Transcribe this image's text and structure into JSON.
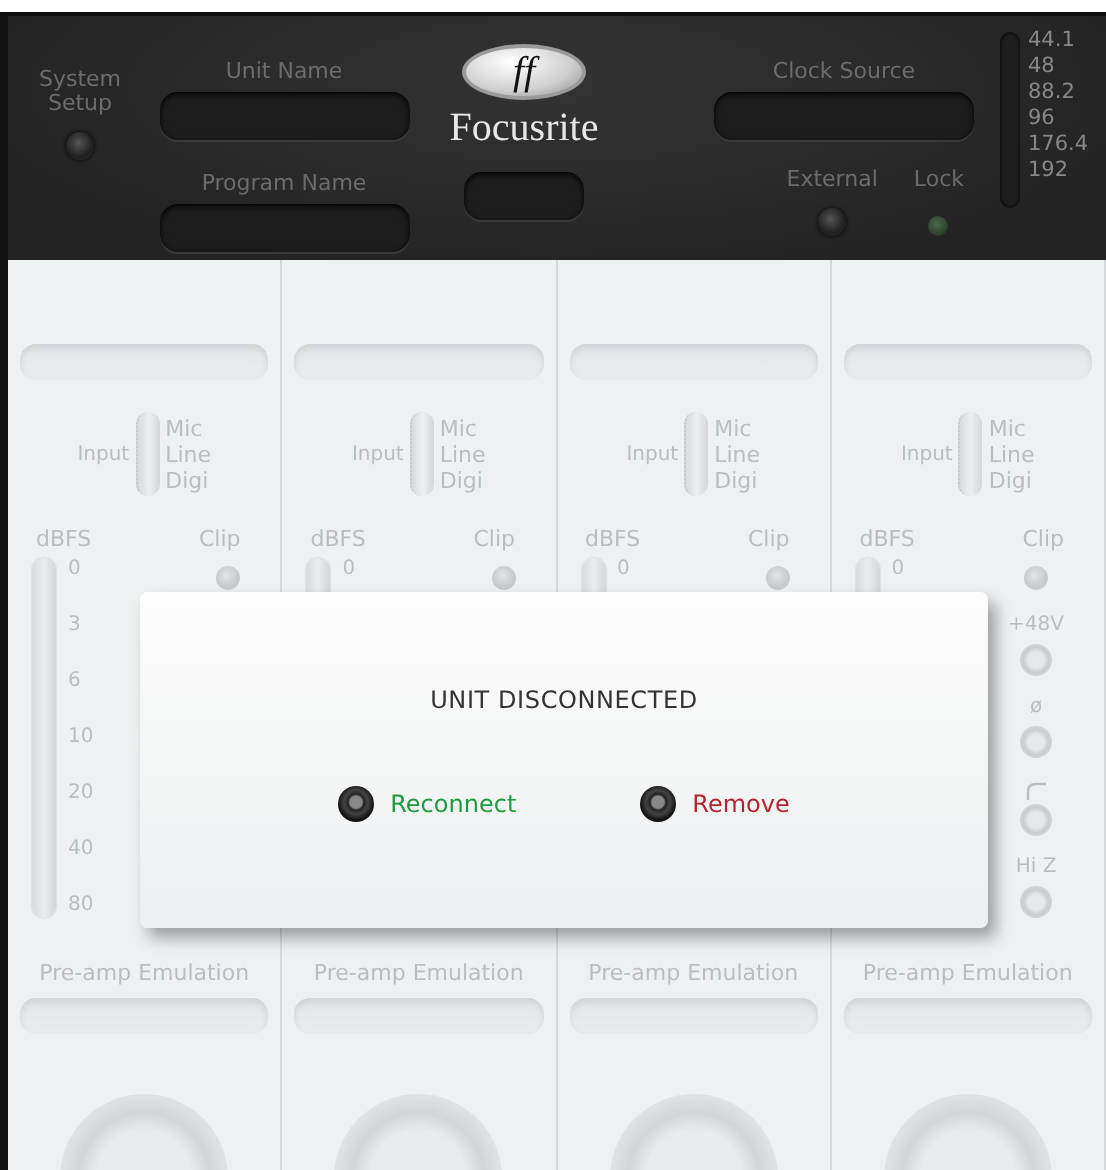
{
  "header": {
    "system_setup": "System Setup",
    "unit_name_label": "Unit Name",
    "program_name_label": "Program Name",
    "logo_mark": "ff",
    "logo_text": "Focusrite",
    "clock_source_label": "Clock Source",
    "external_label": "External",
    "lock_label": "Lock",
    "sample_rates": [
      "44.1",
      "48",
      "88.2",
      "96",
      "176.4",
      "192"
    ]
  },
  "channels": [
    {
      "input_label": "Input",
      "input_options": [
        "Mic",
        "Line",
        "Digi"
      ],
      "dbfs_label": "dBFS",
      "clip_label": "Clip",
      "meter_scale": [
        "0",
        "3",
        "6",
        "10",
        "20",
        "40",
        "80"
      ],
      "preamp_label": "Pre-amp Emulation"
    },
    {
      "input_label": "Input",
      "input_options": [
        "Mic",
        "Line",
        "Digi"
      ],
      "dbfs_label": "dBFS",
      "clip_label": "Clip",
      "meter_scale": [
        "0"
      ],
      "preamp_label": "Pre-amp Emulation"
    },
    {
      "input_label": "Input",
      "input_options": [
        "Mic",
        "Line",
        "Digi"
      ],
      "dbfs_label": "dBFS",
      "clip_label": "Clip",
      "meter_scale": [
        "0"
      ],
      "preamp_label": "Pre-amp Emulation"
    },
    {
      "input_label": "Input",
      "input_options": [
        "Mic",
        "Line",
        "Digi"
      ],
      "dbfs_label": "dBFS",
      "clip_label": "Clip",
      "meter_scale": [
        "0"
      ],
      "switches": [
        {
          "kind": "text",
          "label": "+48V"
        },
        {
          "kind": "text",
          "label": "ø"
        },
        {
          "kind": "icon"
        },
        {
          "kind": "text",
          "label": "Hi Z"
        }
      ],
      "preamp_label": "Pre-amp Emulation"
    }
  ],
  "dialog": {
    "title": "UNIT DISCONNECTED",
    "buttons": [
      {
        "label": "Reconnect",
        "color": "#1f9a3e"
      },
      {
        "label": "Remove",
        "color": "#b3232b"
      }
    ]
  }
}
